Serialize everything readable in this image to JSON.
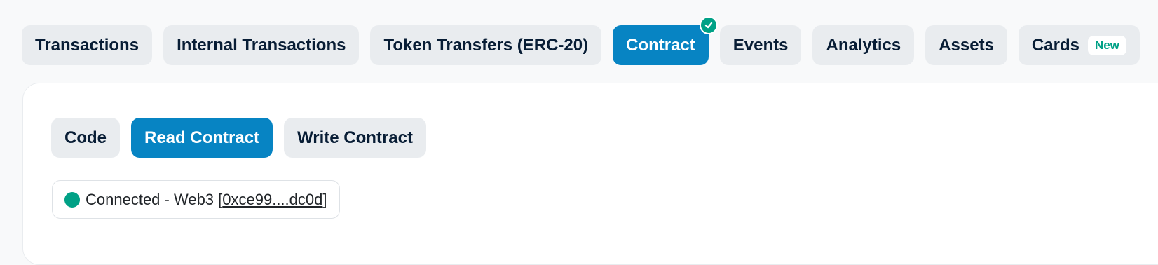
{
  "tabs": [
    {
      "label": "Transactions"
    },
    {
      "label": "Internal Transactions"
    },
    {
      "label": "Token Transfers (ERC-20)"
    },
    {
      "label": "Contract"
    },
    {
      "label": "Events"
    },
    {
      "label": "Analytics"
    },
    {
      "label": "Assets"
    },
    {
      "label": "Cards",
      "badge": "New"
    }
  ],
  "active_tab": "Contract",
  "subtabs": [
    {
      "label": "Code"
    },
    {
      "label": "Read Contract"
    },
    {
      "label": "Write Contract"
    }
  ],
  "active_subtab": "Read Contract",
  "connection": {
    "status_text": "Connected - Web3 [",
    "address": "0xce99....dc0d",
    "close_bracket": "]"
  },
  "colors": {
    "accent": "#0784c3",
    "success": "#00a186",
    "tab_bg": "#e9ecef",
    "text": "#081d35"
  },
  "icons": {
    "contract_verified": "check-circle-icon",
    "connection_status": "status-dot-icon"
  }
}
